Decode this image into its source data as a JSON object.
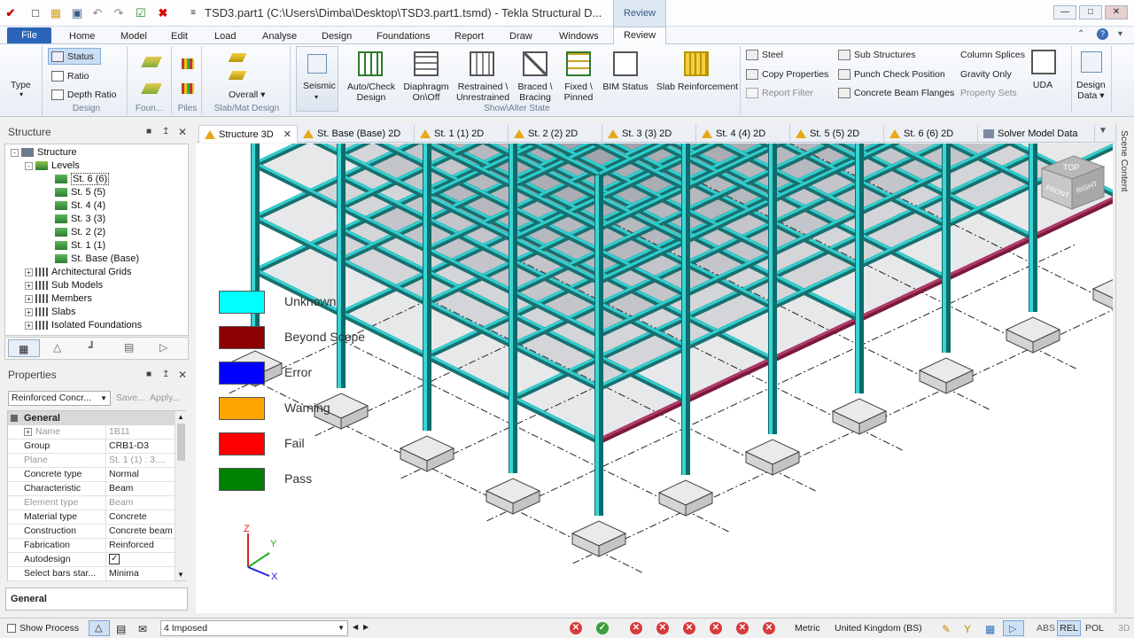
{
  "window": {
    "title": "TSD3.part1 (C:\\Users\\Dimba\\Desktop\\TSD3.part1.tsmd) - Tekla Structural D...",
    "context_tab": "Review",
    "controls": [
      "—",
      "□",
      "✕"
    ]
  },
  "ribbon_tabs": [
    "File",
    "Home",
    "Model",
    "Edit",
    "Load",
    "Analyse",
    "Design",
    "Foundations",
    "Report",
    "Draw",
    "Windows",
    "Review"
  ],
  "ribbon": {
    "type_label": "Type",
    "status": "Status",
    "ratio": "Ratio",
    "depth_ratio": "Depth Ratio",
    "design_group": "Design",
    "found_group": "Foun...",
    "piles_group": "Piles",
    "slab_group": "Slab/Mat Design",
    "overall": "Overall",
    "seismic": "Seismic",
    "auto_check": [
      "Auto/Check",
      "Design"
    ],
    "diaphragm": [
      "Diaphragm",
      "On\\Off"
    ],
    "restrained": [
      "Restrained \\",
      "Unrestrained"
    ],
    "braced": [
      "Braced \\",
      "Bracing"
    ],
    "fixed": [
      "Fixed \\",
      "Pinned"
    ],
    "bim_status": "BIM Status",
    "slab_reinforcement": "Slab Reinforcement",
    "steel": "Steel",
    "copy_properties": "Copy Properties",
    "report_filter": "Report Filter",
    "sub_structures": "Sub Structures",
    "punch_check": "Punch Check Position",
    "concrete_flanges": "Concrete Beam Flanges",
    "column_splices": "Column Splices",
    "gravity_only": "Gravity Only",
    "property_sets": "Property Sets",
    "show_alter": "Show\\Alter State",
    "uda": "UDA",
    "design_data": [
      "Design",
      "Data"
    ]
  },
  "structure_panel": {
    "title": "Structure",
    "tree": [
      {
        "label": "Structure",
        "level": 0
      },
      {
        "label": "Levels",
        "level": 1
      },
      {
        "label": "St. 6 (6)",
        "level": 2
      },
      {
        "label": "St. 5 (5)",
        "level": 2
      },
      {
        "label": "St. 4 (4)",
        "level": 2
      },
      {
        "label": "St. 3 (3)",
        "level": 2
      },
      {
        "label": "St. 2 (2)",
        "level": 2
      },
      {
        "label": "St. 1 (1)",
        "level": 2
      },
      {
        "label": "St. Base (Base)",
        "level": 2
      },
      {
        "label": "Architectural Grids",
        "level": 1
      },
      {
        "label": "Sub Models",
        "level": 1
      },
      {
        "label": "Members",
        "level": 1
      },
      {
        "label": "Slabs",
        "level": 1
      },
      {
        "label": "Isolated Foundations",
        "level": 1
      }
    ]
  },
  "properties_panel": {
    "title": "Properties",
    "selector": "Reinforced Concr...",
    "save": "Save...",
    "apply": "Apply...",
    "section": "General",
    "rows": [
      {
        "key": "Name",
        "value": "1B11",
        "dim": true
      },
      {
        "key": "Group",
        "value": "CRB1-D3",
        "dim": false
      },
      {
        "key": "Plane",
        "value": "St. 1 (1) : 3....",
        "dim": true
      },
      {
        "key": "Concrete type",
        "value": "Normal",
        "dim": false
      },
      {
        "key": "Characteristic",
        "value": "Beam",
        "dim": false
      },
      {
        "key": "Element type",
        "value": "Beam",
        "dim": true
      },
      {
        "key": "Material type",
        "value": "Concrete",
        "dim": false
      },
      {
        "key": "Construction",
        "value": "Concrete beam",
        "dim": false
      },
      {
        "key": "Fabrication",
        "value": "Reinforced",
        "dim": false
      },
      {
        "key": "Autodesign",
        "value": "✓",
        "dim": false
      },
      {
        "key": "Select bars star...",
        "value": "Minima",
        "dim": false
      }
    ],
    "footer": "General"
  },
  "view_tabs": [
    "Structure 3D",
    "St. Base (Base) 2D",
    "St. 1 (1) 2D",
    "St. 2 (2) 2D",
    "St. 3 (3) 2D",
    "St. 4 (4) 2D",
    "St. 5 (5) 2D",
    "St. 6 (6) 2D",
    "Solver Model Data"
  ],
  "scene_content": "Scene Content",
  "legend": [
    {
      "label": "Unknown",
      "color": "#00ffff"
    },
    {
      "label": "Beyond Scope",
      "color": "#8b0000"
    },
    {
      "label": "Error",
      "color": "#0000ff"
    },
    {
      "label": "Warning",
      "color": "#ffa500"
    },
    {
      "label": "Fail",
      "color": "#ff0000"
    },
    {
      "label": "Pass",
      "color": "#008000"
    }
  ],
  "axes": {
    "z": "Z",
    "y": "Y",
    "x": "X"
  },
  "viewcube": {
    "top": "TOP",
    "front": "FRONT",
    "right": "RIGHT"
  },
  "statusbar": {
    "show_process": "Show Process",
    "loadcase": "4 Imposed",
    "units": "Metric",
    "code": "United Kingdom (BS)",
    "abs": "ABS",
    "rel": "REL",
    "pol": "POL",
    "threed": "3D"
  }
}
